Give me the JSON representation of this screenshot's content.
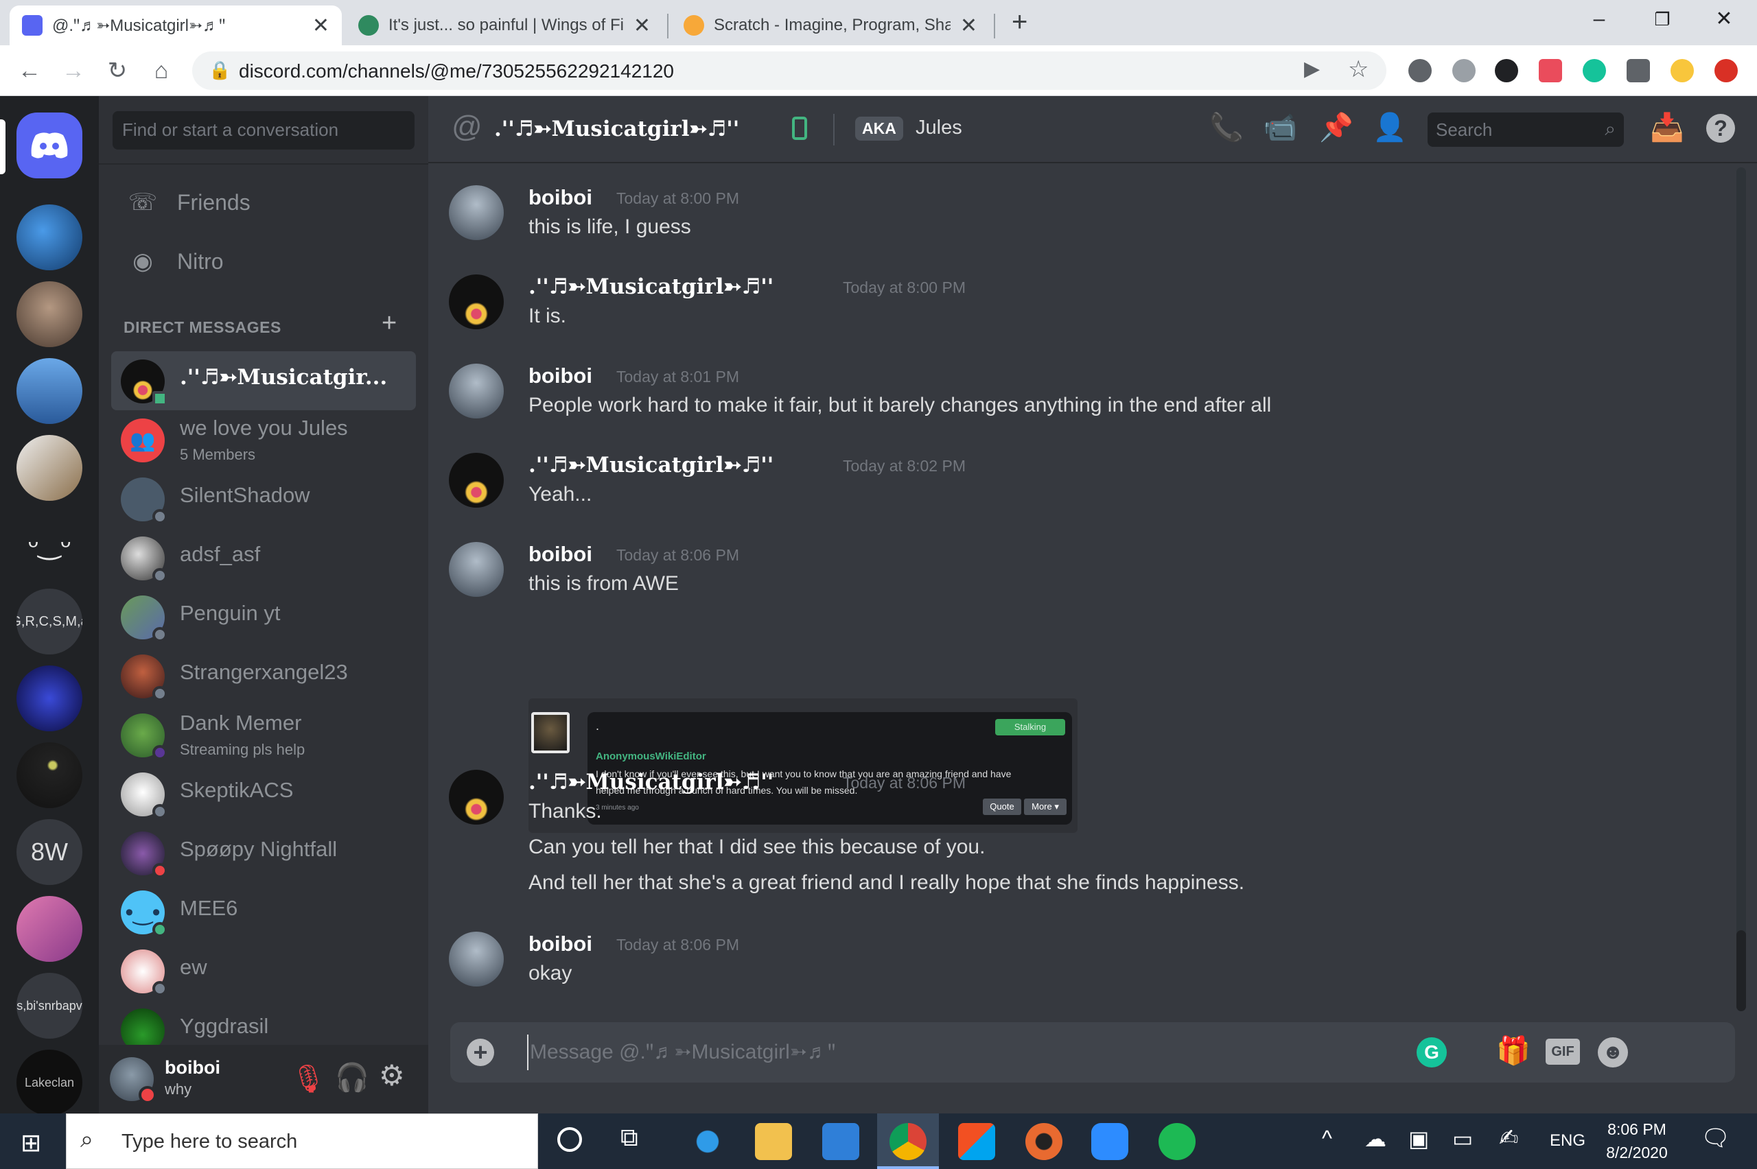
{
  "browser": {
    "tabs": [
      {
        "title": "@.ꞌꞌ♬➳Musicatgirl➳♬ꞌꞌ",
        "active": true
      },
      {
        "title": "It's just... so painful | Wings of Fir",
        "active": false
      },
      {
        "title": "Scratch - Imagine, Program, Shar",
        "active": false
      }
    ],
    "new_tab_label": "+",
    "url": "discord.com/channels/@me/730525562292142120"
  },
  "servers": [
    {
      "label": "",
      "color": "#5865f2"
    },
    {
      "label": "",
      "color": "#2d6fc0"
    },
    {
      "label": "",
      "color": "#6b5a4f"
    },
    {
      "label": "",
      "color": "#3f87d6"
    },
    {
      "label": "",
      "color": "#8a6e4a"
    },
    {
      "label": "",
      "color": "#202225"
    },
    {
      "label": "G,R,C,S,M,a",
      "color": "#36393f"
    },
    {
      "label": "",
      "color": "#15145c"
    },
    {
      "label": "",
      "color": "#1c1c1c"
    },
    {
      "label": "8W",
      "color": "#36393f"
    },
    {
      "label": "",
      "color": "#c25b8a"
    },
    {
      "label": "s,bi'snrbapv",
      "color": "#36393f"
    },
    {
      "label": "Lakeclan",
      "color": "#0f0f0f"
    }
  ],
  "sidebar": {
    "search_placeholder": "Find or start a conversation",
    "friends_label": "Friends",
    "nitro_label": "Nitro",
    "dm_header": "DIRECT MESSAGES",
    "dm_add": "+",
    "dms": [
      {
        "name": ".ꞌꞌ♬➳Musicatgir...",
        "sub": "",
        "selected": true,
        "avatar_color": "#111111",
        "status": "#43b581"
      },
      {
        "name": "we love you Jules",
        "sub": "5 Members",
        "selected": false,
        "avatar_color": "#ed4245",
        "status": ""
      },
      {
        "name": "SilentShadow",
        "sub": "",
        "selected": false,
        "avatar_color": "#4a5a6a",
        "status": "#747f8d"
      },
      {
        "name": "adsf_asf",
        "sub": "",
        "selected": false,
        "avatar_color": "#5e6166",
        "status": "#747f8d"
      },
      {
        "name": "Penguin yt",
        "sub": "",
        "selected": false,
        "avatar_color": "#5d8a5e",
        "status": "#747f8d"
      },
      {
        "name": "Strangerxangel23",
        "sub": "",
        "selected": false,
        "avatar_color": "#7a3a2a",
        "status": "#747f8d"
      },
      {
        "name": "Dank Memer",
        "sub": "Streaming pls help",
        "selected": false,
        "avatar_color": "#4e8a3a",
        "status": "#593695"
      },
      {
        "name": "SkeptikACS",
        "sub": "",
        "selected": false,
        "avatar_color": "#e8e8e8",
        "status": "#747f8d"
      },
      {
        "name": "Spøøpy Nightfall",
        "sub": "",
        "selected": false,
        "avatar_color": "#3a2a4a",
        "status": "#ed4245"
      },
      {
        "name": "MEE6",
        "sub": "",
        "selected": false,
        "avatar_color": "#4fc3f7",
        "status": "#43b581"
      },
      {
        "name": "ew",
        "sub": "",
        "selected": false,
        "avatar_color": "#e0e0e0",
        "status": "#747f8d"
      },
      {
        "name": "Yggdrasil",
        "sub": "",
        "selected": false,
        "avatar_color": "#2a7a2a",
        "status": ""
      }
    ],
    "user": {
      "name": "boiboi",
      "status": "why"
    }
  },
  "chat": {
    "channel_prefix": "@",
    "channel_name": ".ꞌꞌ♬➳Musicatgirl➳♬ꞌꞌ",
    "aka_badge": "AKA",
    "aka_name": "Jules",
    "search_placeholder": "Search",
    "messages": [
      {
        "author": "boiboi",
        "time": "Today at 8:00 PM",
        "lines": [
          "this is life, I guess"
        ],
        "avatar_color": "#5e6a78"
      },
      {
        "author": ".ꞌꞌ♬➳Musicatgirl➳♬ꞌꞌ",
        "time": "Today at 8:00 PM",
        "lines": [
          "It is."
        ],
        "avatar_color": "#111111"
      },
      {
        "author": "boiboi",
        "time": "Today at 8:01 PM",
        "lines": [
          "People work hard to make it fair, but it barely changes anything in the end after all"
        ],
        "avatar_color": "#5e6a78"
      },
      {
        "author": ".ꞌꞌ♬➳Musicatgirl➳♬ꞌꞌ",
        "time": "Today at 8:02 PM",
        "lines": [
          "Yeah..."
        ],
        "avatar_color": "#111111"
      },
      {
        "author": "boiboi",
        "time": "Today at 8:06 PM",
        "lines": [
          "this is from AWE"
        ],
        "avatar_color": "#5e6a78"
      },
      {
        "author": ".ꞌꞌ♬➳Musicatgirl➳♬ꞌꞌ",
        "time": "Today at 8:06 PM",
        "lines": [
          "Thanks.",
          "Can you tell her that I did see this because of you.",
          "And tell her that she's a great friend and I really hope that she finds happiness."
        ],
        "avatar_color": "#111111"
      },
      {
        "author": "boiboi",
        "time": "Today at 8:06 PM",
        "lines": [
          "okay"
        ],
        "avatar_color": "#5e6a78"
      }
    ],
    "embed": {
      "dot": ".",
      "badge": "Stalking",
      "username": "AnonymousWikiEditor",
      "text_line1": "I don't know if you'll ever see this, but I want you to know that you are an amazing friend and have",
      "text_line2": "helped me through a bunch of hard times. You will be missed.",
      "time": "3 minutes ago",
      "quote_label": "Quote",
      "more_label": "More ▾"
    },
    "input_placeholder": "Message @.ꞌꞌ♬➳Musicatgirl➳♬ꞌꞌ",
    "gif_label": "GIF"
  },
  "taskbar": {
    "search_placeholder": "Type here to search",
    "lang": "ENG",
    "time": "8:06 PM",
    "date": "8/2/2020"
  },
  "colors": {
    "discord_blurple": "#5865f2",
    "accent_green": "#43b581",
    "embed_green": "#3ba55c",
    "grammarly": "#15c39a"
  }
}
